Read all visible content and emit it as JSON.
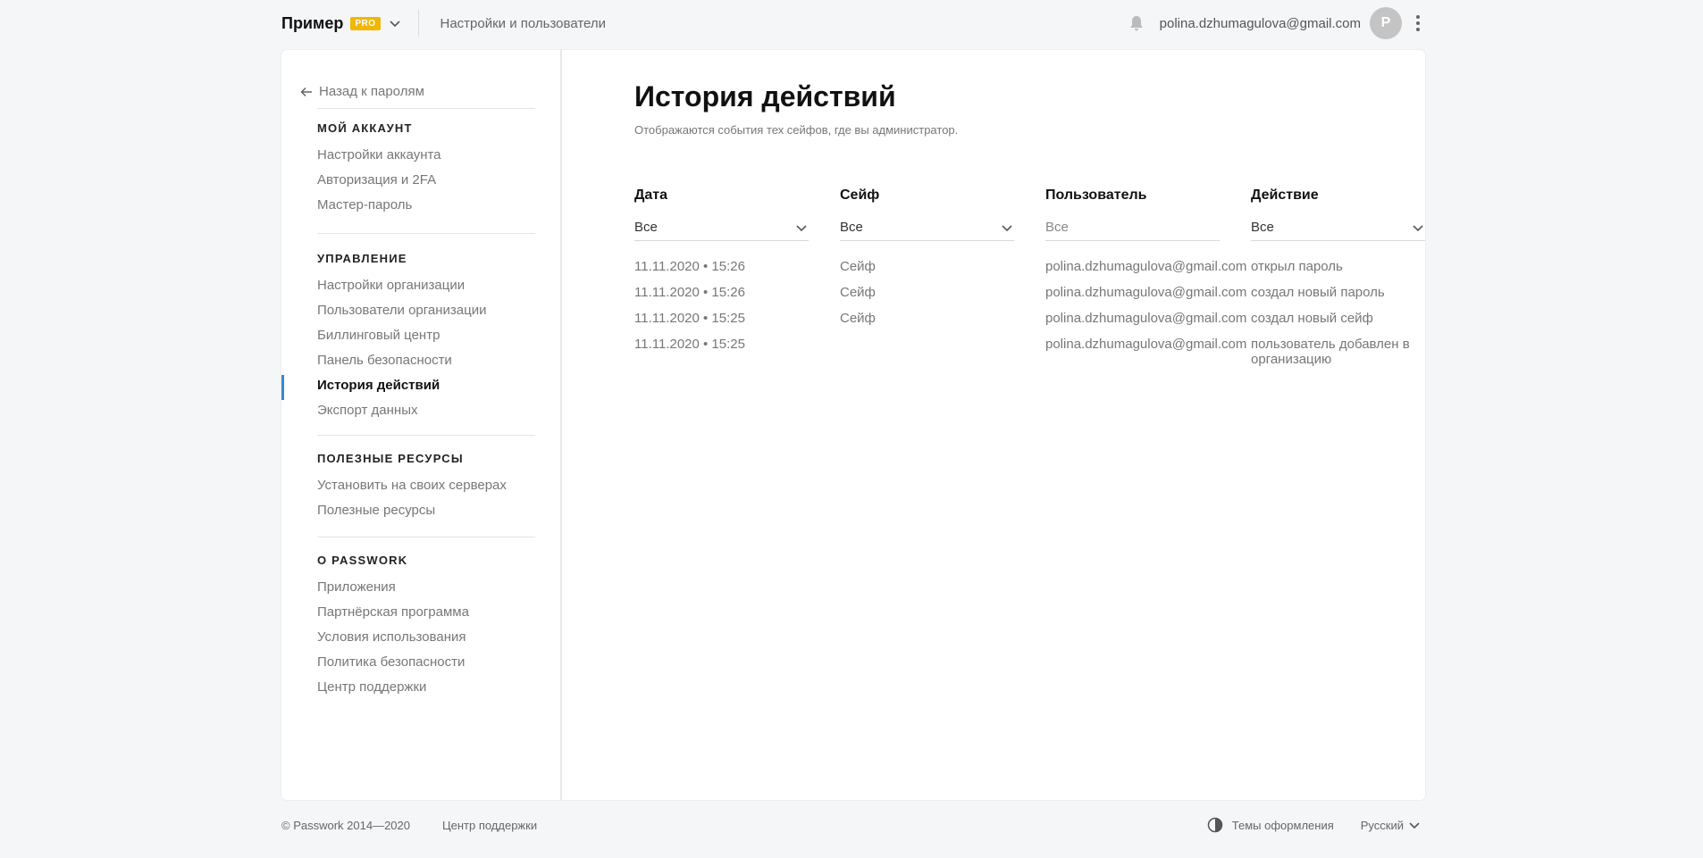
{
  "header": {
    "brand": "Пример",
    "badge": "PRO",
    "section_link": "Настройки и пользователи",
    "user_email": "polina.dzhumagulova@gmail.com",
    "avatar_letter": "P"
  },
  "sidebar": {
    "back_label": "Назад к паролям",
    "sections": [
      {
        "heading": "МОЙ АККАУНТ",
        "items": [
          "Настройки аккаунта",
          "Авторизация и 2FA",
          "Мастер-пароль"
        ]
      },
      {
        "heading": "УПРАВЛЕНИЕ",
        "items": [
          "Настройки организации",
          "Пользователи организации",
          "Биллинговый центр",
          "Панель безопасности",
          "История действий",
          "Экспорт данных"
        ]
      },
      {
        "heading": "ПОЛЕЗНЫЕ РЕСУРСЫ",
        "items": [
          "Установить на своих серверах",
          "Полезные ресурсы"
        ]
      },
      {
        "heading": "О PASSWORK",
        "items": [
          "Приложения",
          "Партнёрская программа",
          "Условия использования",
          "Политика безопасности",
          "Центр поддержки"
        ]
      }
    ],
    "active_item": "История действий"
  },
  "main": {
    "title": "История действий",
    "subtitle": "Отображаются события тех сейфов, где вы администратор.",
    "filters": [
      {
        "label": "Дата",
        "value": "Все",
        "kind": "select"
      },
      {
        "label": "Сейф",
        "value": "Все",
        "kind": "select"
      },
      {
        "label": "Пользователь",
        "placeholder": "Все",
        "kind": "input"
      },
      {
        "label": "Действие",
        "value": "Все",
        "kind": "select"
      }
    ],
    "rows": [
      {
        "date": "11.11.2020 • 15:26",
        "safe": "Сейф",
        "user": "polina.dzhumagulova@gmail.com",
        "action": "открыл пароль"
      },
      {
        "date": "11.11.2020 • 15:26",
        "safe": "Сейф",
        "user": "polina.dzhumagulova@gmail.com",
        "action": "создал новый пароль"
      },
      {
        "date": "11.11.2020 • 15:25",
        "safe": "Сейф",
        "user": "polina.dzhumagulova@gmail.com",
        "action": "создал новый сейф"
      },
      {
        "date": "11.11.2020 • 15:25",
        "safe": "",
        "user": "polina.dzhumagulova@gmail.com",
        "action": "пользователь добавлен в организацию"
      }
    ]
  },
  "footer": {
    "copyright": "© Passwork 2014—2020",
    "support": "Центр поддержки",
    "themes": "Темы оформления",
    "language": "Русский"
  },
  "colors": {
    "accent": "#3a86d6",
    "badge": "#f2b705",
    "background": "#f5f6f8"
  }
}
